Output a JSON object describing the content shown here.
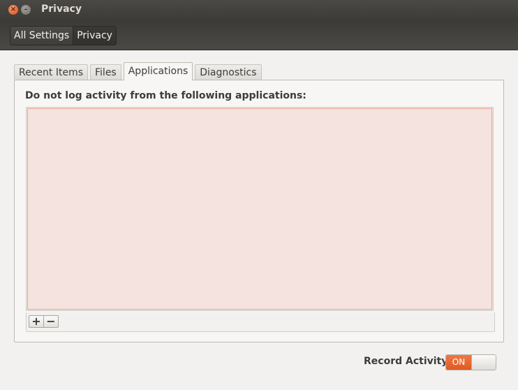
{
  "window": {
    "title": "Privacy",
    "close_glyph": "×",
    "min_glyph": "–"
  },
  "breadcrumb": {
    "items": [
      "All Settings",
      "Privacy"
    ]
  },
  "tabs": [
    {
      "label": "Recent Items",
      "active": false
    },
    {
      "label": "Files",
      "active": false
    },
    {
      "label": "Applications",
      "active": true
    },
    {
      "label": "Diagnostics",
      "active": false
    }
  ],
  "applications": {
    "heading": "Do not log activity from the following applications:",
    "add_label": "+",
    "remove_label": "−"
  },
  "record": {
    "label": "Record Activity",
    "state": "ON"
  },
  "colors": {
    "accent": "#e05a22",
    "list_background": "#f4e3df"
  }
}
